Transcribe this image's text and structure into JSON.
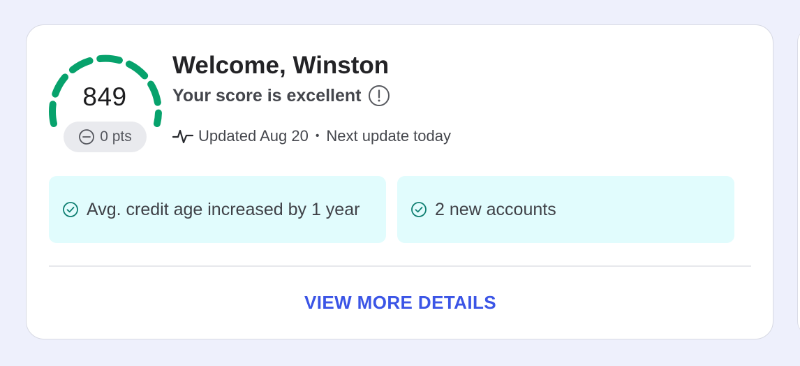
{
  "score": {
    "value": "849",
    "change_label": "0 pts",
    "gauge_color": "#07a26c"
  },
  "header": {
    "welcome_text": "Welcome, Winston",
    "status_text": "Your score is excellent",
    "info_icon": "info-icon"
  },
  "update": {
    "updated_label": "Updated Aug 20",
    "separator": "•",
    "next_update_label": "Next update today",
    "icon": "activity-icon"
  },
  "factors": [
    {
      "text": "Avg. credit age increased by 1 year",
      "icon": "check-circle-icon"
    },
    {
      "text": "2 new accounts",
      "icon": "check-circle-icon"
    }
  ],
  "actions": {
    "details_label": "VIEW MORE DETAILS"
  },
  "colors": {
    "background": "#eef0fc",
    "tile_background": "#e1fcfd",
    "link": "#3b55e6",
    "check": "#0f7f72"
  }
}
